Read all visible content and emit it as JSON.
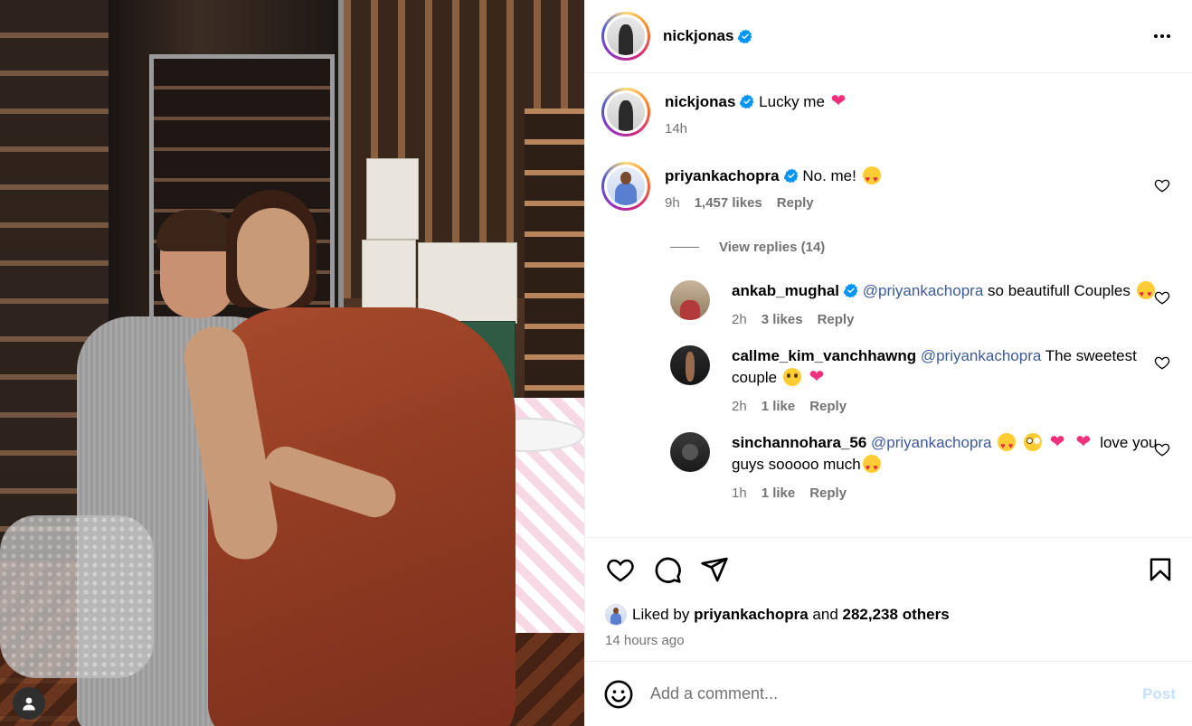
{
  "post": {
    "author": "nickjonas",
    "caption": "Lucky me",
    "caption_time": "14h"
  },
  "comments": [
    {
      "user": "priyankachopra",
      "verified": true,
      "text": "No. me!",
      "time": "9h",
      "likes": "1,457 likes",
      "reply": "Reply"
    }
  ],
  "view_replies": "View replies (14)",
  "replies": [
    {
      "user": "ankab_mughal",
      "verified": true,
      "mention": "@priyankachopra",
      "text": "so beautifull Couples",
      "time": "2h",
      "likes": "3 likes",
      "reply": "Reply"
    },
    {
      "user": "callme_kim_vanchhawng",
      "verified": false,
      "mention": "@priyankachopra",
      "text": "The sweetest couple",
      "time": "2h",
      "likes": "1 like",
      "reply": "Reply"
    },
    {
      "user": "sinchannohara_56",
      "verified": false,
      "mention": "@priyankachopra",
      "text": "love you guys sooooo much",
      "time": "1h",
      "likes": "1 like",
      "reply": "Reply"
    }
  ],
  "likes_line": {
    "prefix": "Liked by",
    "user": "priyankachopra",
    "middle": "and",
    "count": "282,238 others"
  },
  "posted_ago": "14 hours ago",
  "add_comment": {
    "placeholder": "Add a comment...",
    "post_label": "Post"
  },
  "colors": {
    "accent": "#0095f6",
    "heart": "#f0307a",
    "mention": "#3d5a9c",
    "muted": "#737373"
  }
}
